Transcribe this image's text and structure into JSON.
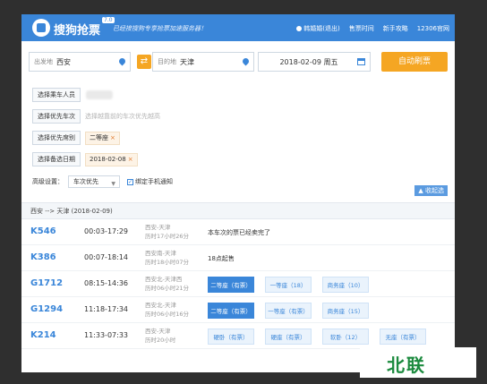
{
  "header": {
    "app_name": "搜狗抢票",
    "version": "7.0",
    "slogan": "已经接搜狗专享抢票加速服务器！",
    "links": {
      "user": "韩婚婚(退出)",
      "server_time": "售票时间",
      "guide": "新手攻略",
      "site": "12306官网"
    }
  },
  "search": {
    "from_label": "出发地",
    "from_value": "西安",
    "swap_icon": "⇄",
    "to_label": "目的地",
    "to_value": "天津",
    "date_value": "2018-02-09  周五",
    "auto_button": "自动刷票"
  },
  "options": {
    "passenger_button": "选择乘车人员",
    "train_button": "选择优先车次",
    "train_hint": "选择越靠前的车次优先越高",
    "seat_button": "选择优先席别",
    "seat_chip": "二等座",
    "date_button": "选择备选日期",
    "date_chip": "2018-02-08",
    "chip_close": "×"
  },
  "advanced": {
    "label": "高级设置：",
    "select_value": "车次优先",
    "select_arrow": "▼",
    "check_mark": "✓",
    "check_label": "绑定手机通知",
    "collapse": "▲ 收起选"
  },
  "results": {
    "route": "西安 --> 天津 (2018-02-09)",
    "trains": [
      {
        "no": "K546",
        "time": "00:03-17:29",
        "stations": "西安-天津",
        "duration": "历时17小时26分",
        "message": "本车次的票已经卖完了",
        "seats": []
      },
      {
        "no": "K386",
        "time": "00:07-18:14",
        "stations": "西安南-天津",
        "duration": "历时18小时07分",
        "message": "18点起售",
        "seats": []
      },
      {
        "no": "G1712",
        "time": "08:15-14:36",
        "stations": "西安北-天津西",
        "duration": "历时06小时21分",
        "message": "",
        "seats": [
          "二等座（有票）",
          "一等座（18）",
          "商务座（10）"
        ]
      },
      {
        "no": "G1294",
        "time": "11:18-17:34",
        "stations": "西安北-天津",
        "duration": "历时06小时16分",
        "message": "",
        "seats": [
          "二等座（有票）",
          "一等座（有票）",
          "商务座（15）"
        ]
      },
      {
        "no": "K214",
        "time": "11:33-07:33",
        "stations": "西安-天津",
        "duration": "历时20小时",
        "message": "",
        "seats": [
          "硬卧（有票）",
          "硬座（有票）",
          "软卧（12）",
          "无座（有票）"
        ]
      }
    ]
  },
  "watermark": "北联"
}
